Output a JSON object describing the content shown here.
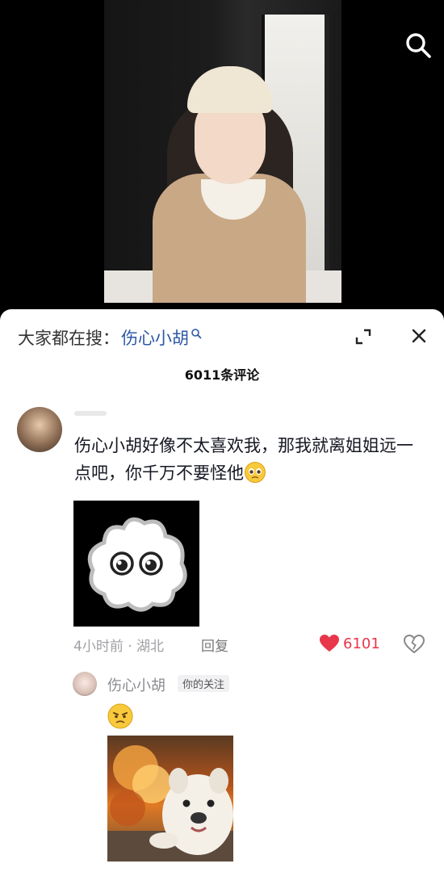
{
  "search_suggest": {
    "prefix": "大家都在搜：",
    "term": "伤心小胡"
  },
  "comments": {
    "count_title": "6011条评论",
    "top": {
      "text": "伤心小胡好像不太喜欢我，那我就离姐姐远一点吧，你千万不要怪他",
      "meta": "4小时前 · 湖北",
      "reply_label": "回复",
      "likes": "6101",
      "liked": true
    },
    "reply": {
      "username": "伤心小胡",
      "badge": "你的关注"
    }
  },
  "icons": {
    "search": "search-icon",
    "expand": "expand-icon",
    "close": "close-icon",
    "heart": "heart-icon",
    "dislike": "broken-heart-icon"
  },
  "colors": {
    "search_term": "#2c58a6",
    "like": "#e8364b"
  }
}
